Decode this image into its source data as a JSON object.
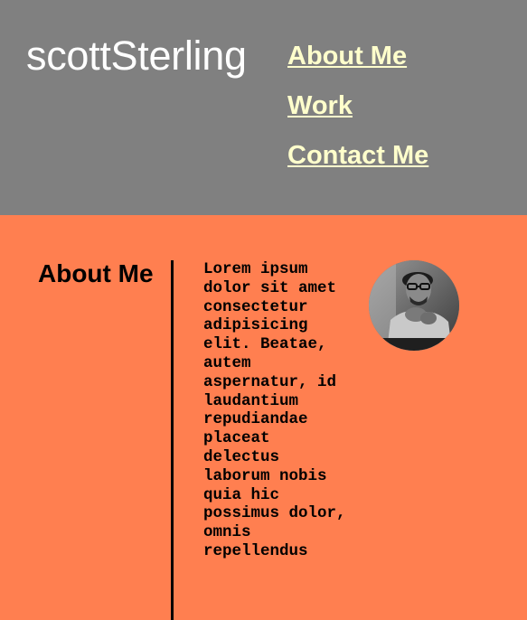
{
  "header": {
    "logo": "scottSterling",
    "nav": [
      {
        "label": "About Me"
      },
      {
        "label": "Work"
      },
      {
        "label": "Contact Me"
      }
    ]
  },
  "about": {
    "heading": "About Me",
    "body": "Lorem ipsum dolor sit amet consectetur adipisicing elit. Beatae, autem aspernatur, id laudantium repudiandae placeat delectus laborum nobis quia hic possimus dolor, omnis repellendus"
  },
  "colors": {
    "header_bg": "#808080",
    "page_bg": "#ff7f50",
    "nav_link": "#ffffcc",
    "logo_text": "#ffffff"
  }
}
